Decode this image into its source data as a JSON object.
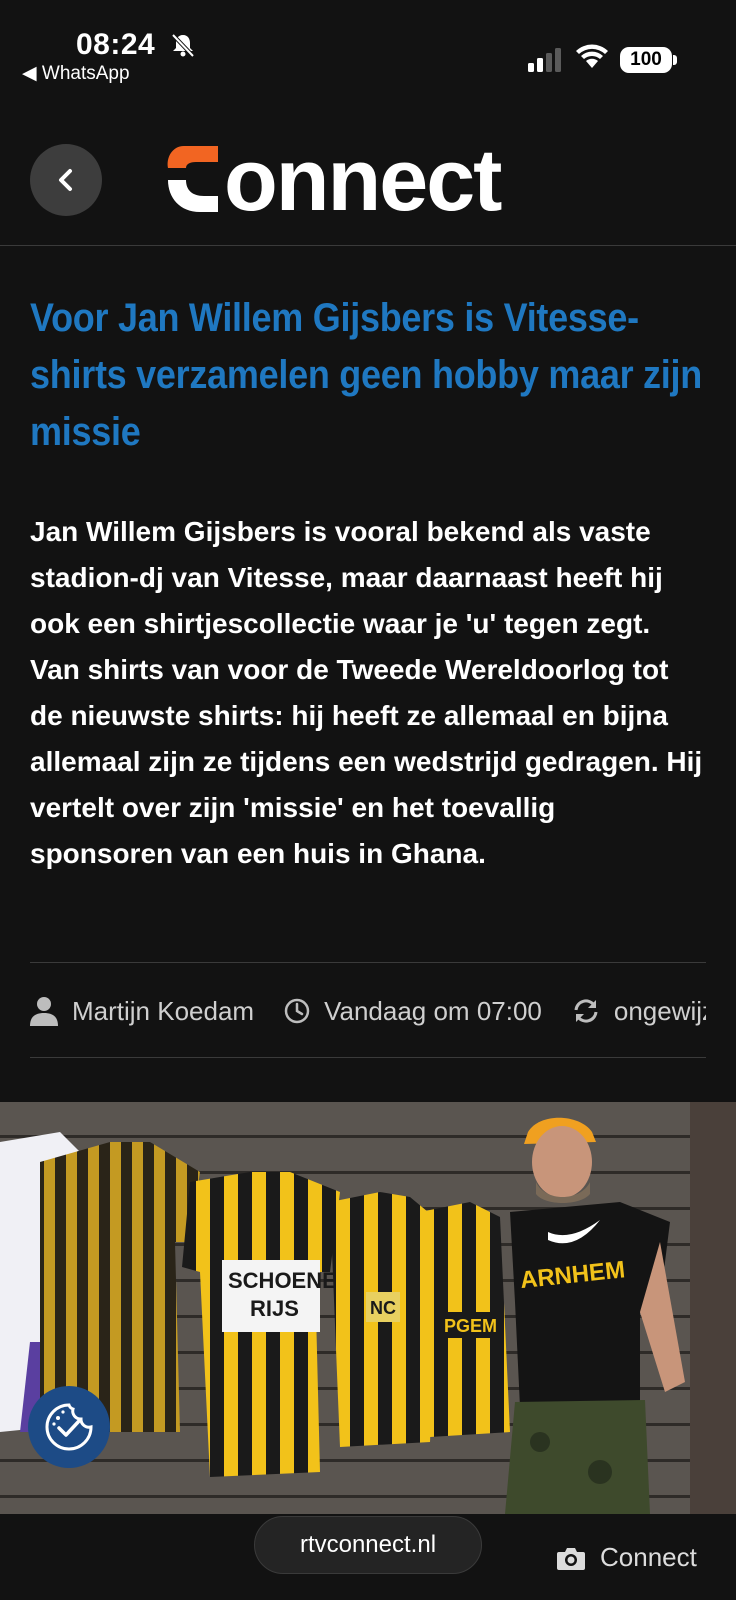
{
  "status_bar": {
    "time": "08:24",
    "back_app": "◀ WhatsApp",
    "battery": "100"
  },
  "header": {
    "logo_text": "connect",
    "back_icon": "chevron-left-icon",
    "colors": {
      "logo_orange": "#f26522",
      "back_button": "#3d3d3d"
    }
  },
  "article": {
    "title": "Voor Jan Willem Gijsbers is Vitesse-shirts verzamelen geen hobby maar zijn missie",
    "lead": "Jan Willem Gijsbers is vooral bekend als vaste stadion-dj van Vitesse, maar daarnaast heeft hij ook een shirtjescollectie waar je 'u' tegen zegt. Van shirts van voor de Tweede Wereldoorlog tot de nieuwste shirts: hij heeft ze allemaal en bijna allemaal zijn ze tijdens een wedstrijd gedragen. Hij vertelt over zijn 'missie' en het toevallig sponsoren van een huis in Ghana.",
    "colors": {
      "title": "#1f78c1"
    }
  },
  "meta": {
    "author": "Martijn Koedam",
    "date": "Vandaag om 07:00",
    "updated": "ongewijzigd",
    "icons": [
      "person-icon",
      "clock-icon",
      "refresh-icon"
    ]
  },
  "photo": {
    "shirt_texts": [
      "SCHOENEN RIJS",
      "NC",
      "PGEM",
      "ARNHEM"
    ]
  },
  "cookie": {
    "icon": "cookie-check-icon"
  },
  "bottom": {
    "url": "rtvconnect.nl",
    "source_label": "Connect",
    "source_icon": "camera-icon"
  }
}
